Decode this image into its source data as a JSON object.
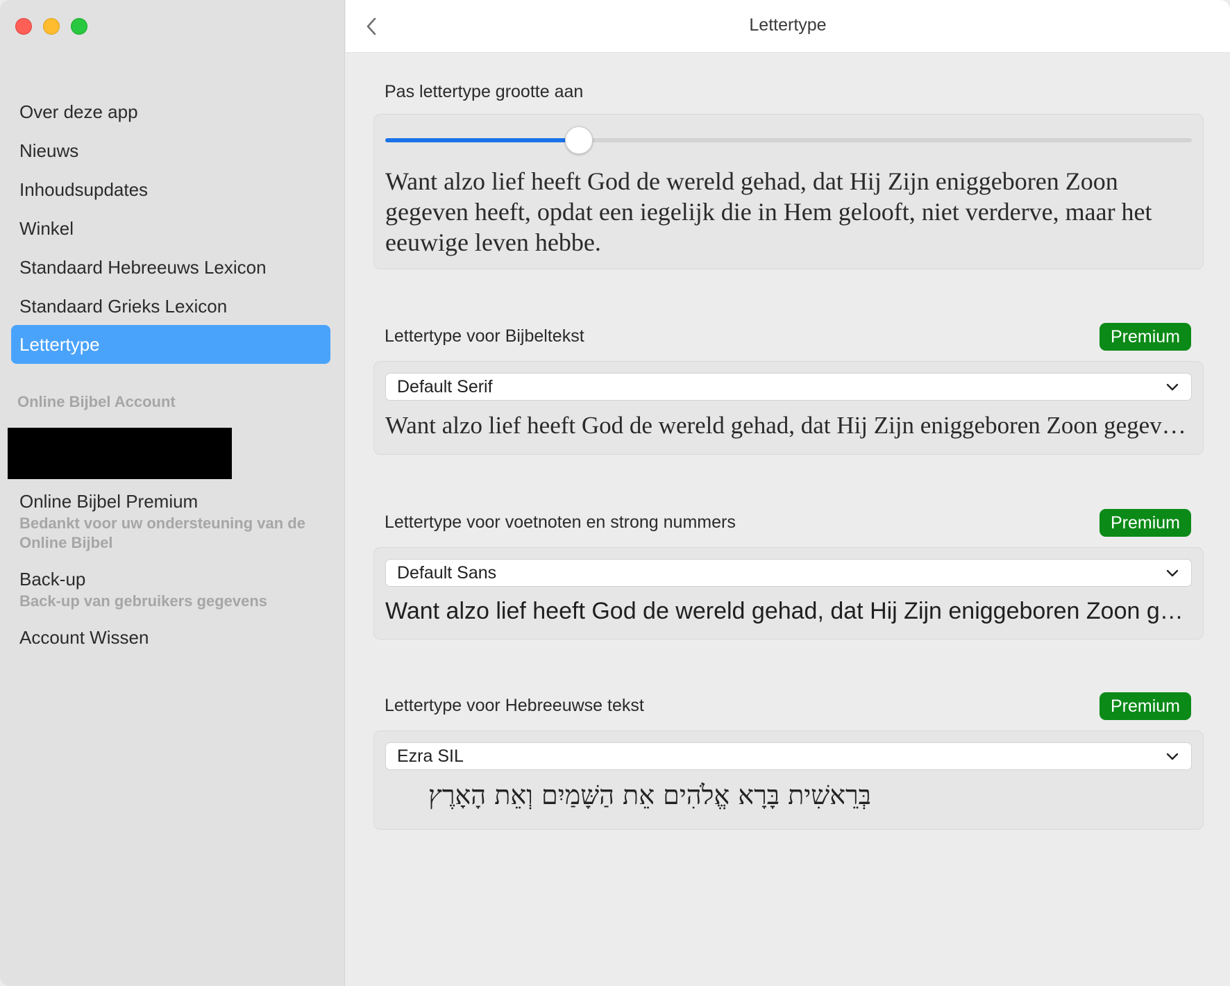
{
  "window": {
    "title": "Lettertype"
  },
  "sidebar": {
    "items": [
      {
        "label": "Over deze app"
      },
      {
        "label": "Nieuws"
      },
      {
        "label": "Inhoudsupdates"
      },
      {
        "label": "Winkel"
      },
      {
        "label": "Standaard Hebreeuws Lexicon"
      },
      {
        "label": "Standaard Grieks Lexicon"
      },
      {
        "label": "Lettertype",
        "active": true
      }
    ],
    "account_section_title": "Online Bijbel Account",
    "premium": {
      "title": "Online Bijbel Premium",
      "subtitle": "Bedankt voor uw ondersteuning van de Online Bijbel"
    },
    "backup": {
      "title": "Back-up",
      "subtitle": "Back-up van gebruikers gegevens"
    },
    "delete_account": "Account Wissen"
  },
  "main": {
    "size_section": {
      "label": "Pas lettertype grootte aan",
      "slider_value_fraction": 0.24,
      "sample_text": "Want alzo lief heeft God de wereld gehad, dat Hij Zijn eniggeboren Zoon gegeven heeft, opdat een iegelijk die in Hem gelooft, niet verderve, maar het eeuwige leven hebbe."
    },
    "bible_font": {
      "label": "Lettertype voor Bijbeltekst",
      "badge": "Premium",
      "selected": "Default Serif",
      "sample_text": "Want alzo lief heeft God de wereld gehad, dat Hij Zijn eniggeboren Zoon gegeven heeft"
    },
    "footnote_font": {
      "label": "Lettertype voor voetnoten en strong nummers",
      "badge": "Premium",
      "selected": "Default Sans",
      "sample_text": "Want alzo lief heeft God de wereld gehad, dat Hij Zijn eniggeboren Zoon gegeven heeft"
    },
    "hebrew_font": {
      "label": "Lettertype voor Hebreeuwse tekst",
      "badge": "Premium",
      "selected": "Ezra SIL",
      "sample_text": "בְּרֵאשִׁית בָּרָא אֱלֹהִים אֵת הַשָּׁמַיִם וְאֵת הָאָרֶץ"
    }
  },
  "colors": {
    "accent": "#4aa3fb",
    "slider": "#1a73e8",
    "premium_badge": "#0b8a17"
  }
}
